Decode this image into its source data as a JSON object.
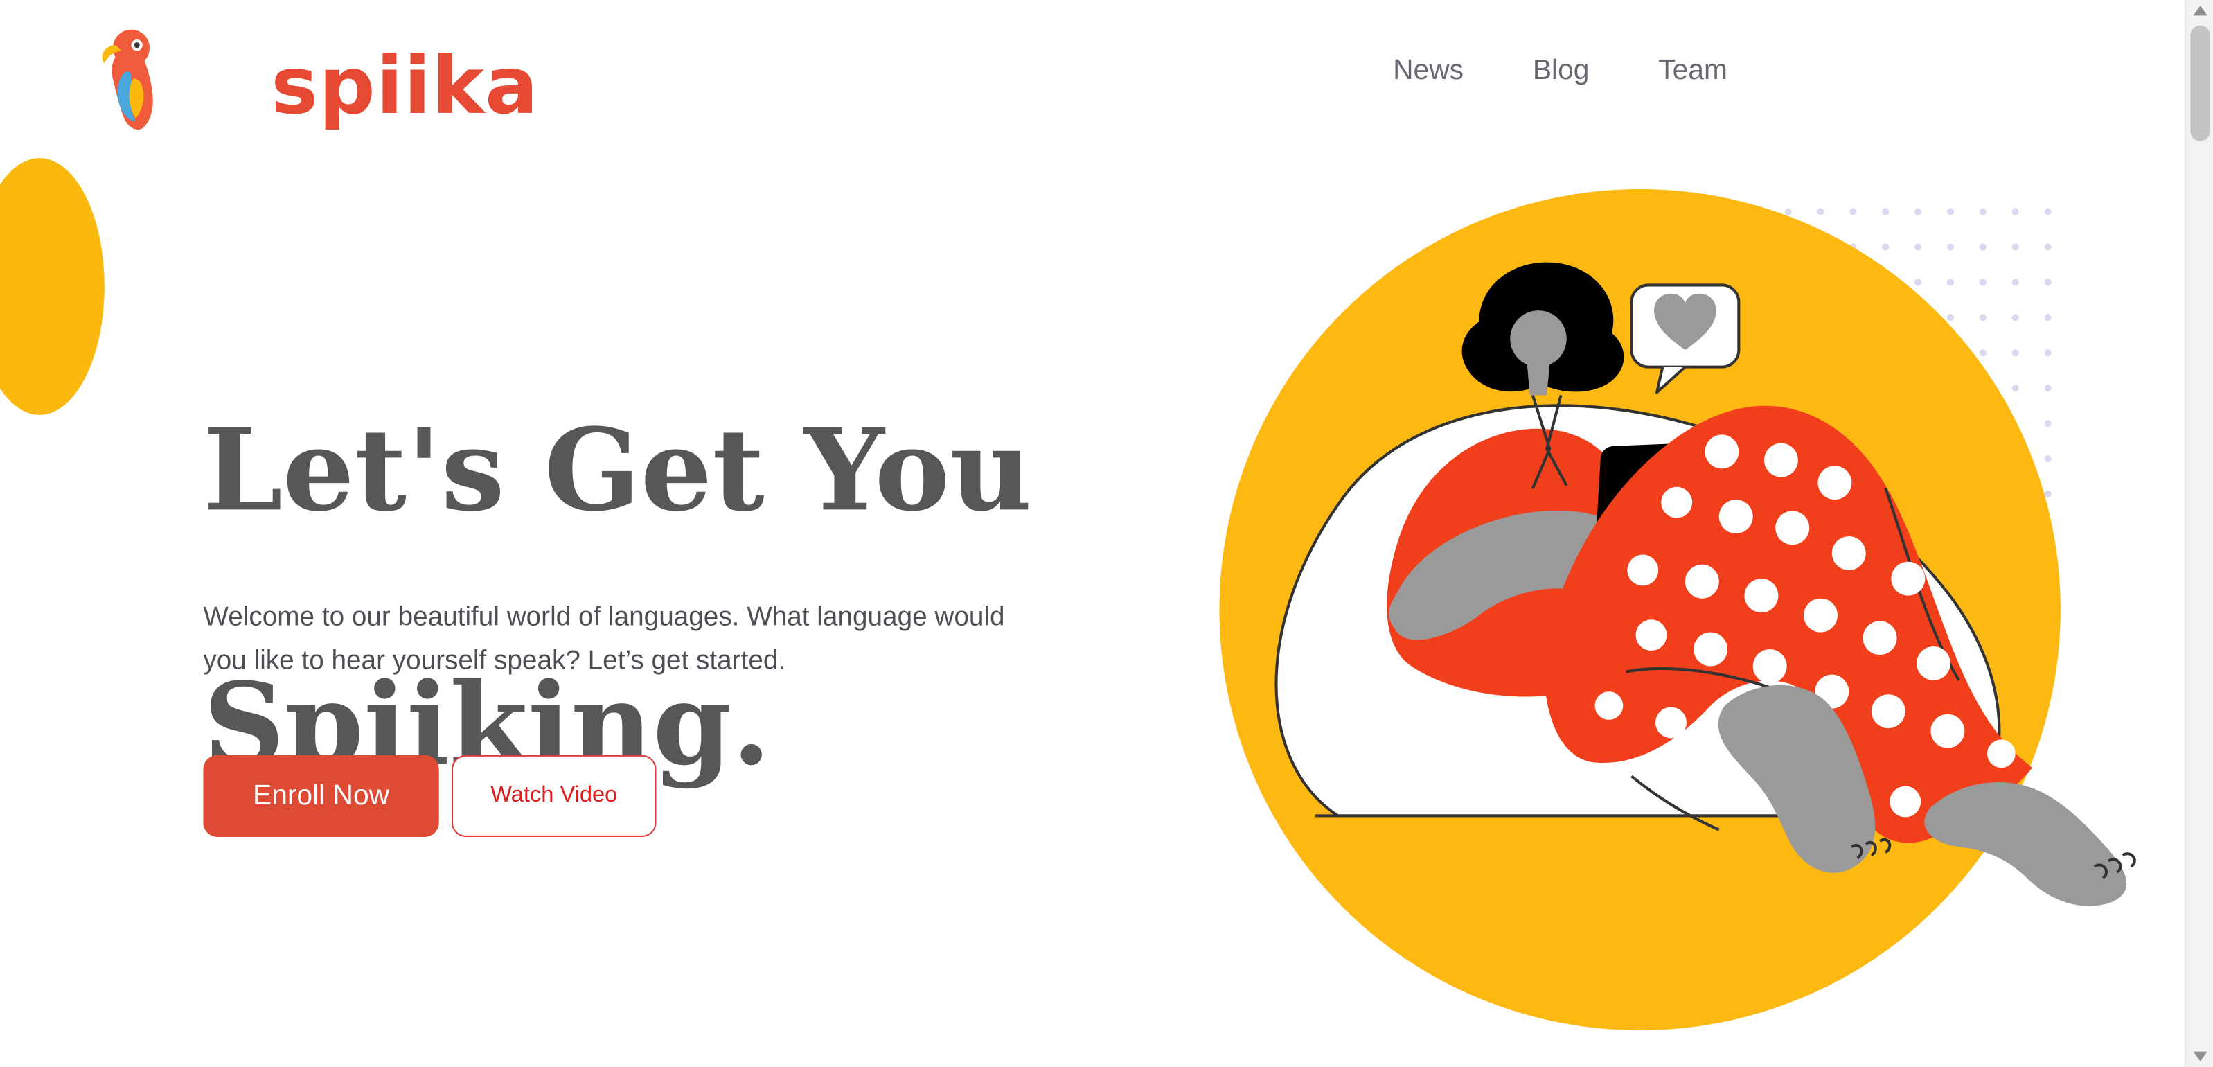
{
  "header": {
    "logo_text": "spiika",
    "nav": [
      {
        "label": "News"
      },
      {
        "label": "Blog"
      },
      {
        "label": "Team"
      }
    ]
  },
  "hero": {
    "title_line1": "Let's Get You",
    "title_line2": "Spiiking.",
    "subtitle": "Welcome to our beautiful world of languages. What language would you like to hear yourself speak? Let’s get started.",
    "primary_button": "Enroll Now",
    "secondary_button": "Watch Video"
  },
  "illustration": {
    "speech_bubble_icon": "heart-icon"
  },
  "colors": {
    "brand_red": "#e64a35",
    "accent_yellow": "#fbb80e",
    "text_dark": "#555759",
    "text_muted": "#666a70"
  }
}
